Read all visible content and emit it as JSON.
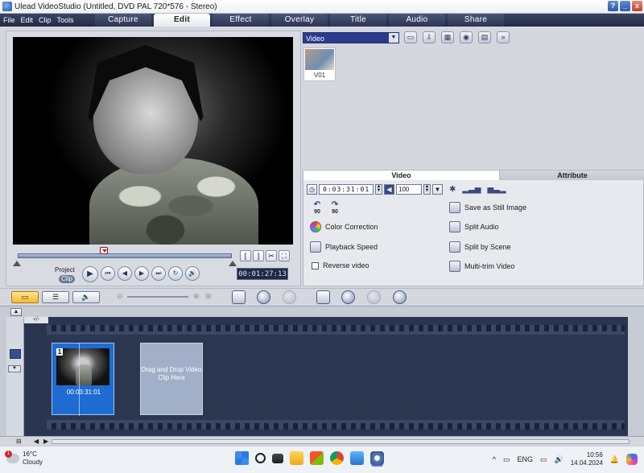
{
  "window": {
    "title": "Ulead VideoStudio (Untitled, DVD PAL 720*576 - Stereo)",
    "btn_help": "?",
    "btn_min": "_",
    "btn_close": "x"
  },
  "menu": [
    "File",
    "Edit",
    "Clip",
    "Tools"
  ],
  "steps": [
    {
      "label": "Capture",
      "active": false
    },
    {
      "label": "Edit",
      "active": true
    },
    {
      "label": "Effect",
      "active": false
    },
    {
      "label": "Overlay",
      "active": false
    },
    {
      "label": "Title",
      "active": false
    },
    {
      "label": "Audio",
      "active": false
    },
    {
      "label": "Share",
      "active": false
    }
  ],
  "preview": {
    "project_label": "Project",
    "clip_label": "Clip",
    "timecode": "00:01:27:13",
    "trim_buttons": [
      "[",
      "]",
      "✂",
      "⛶"
    ],
    "play_glyphs": [
      "▶",
      "⏮",
      "◀",
      "▶",
      "⏭",
      "↻",
      "🔊"
    ]
  },
  "library": {
    "category": "Video",
    "thumbnails": [
      {
        "label": "V01"
      }
    ]
  },
  "options": {
    "tab_video": "Video",
    "tab_attribute": "Attribute",
    "duration": "0:03:31:01",
    "volume": "100",
    "rotate_left": "90",
    "rotate_right": "90",
    "color_correction": "Color Correction",
    "playback_speed": "Playback Speed",
    "reverse_video": "Reverse video",
    "save_still": "Save as Still Image",
    "split_audio": "Split Audio",
    "split_scene": "Split by Scene",
    "multi_trim": "Multi-trim Video"
  },
  "timeline": {
    "clip_number": "1",
    "clip_duration": "00:03:31:01",
    "drop_text": "Drag and Drop Video Clip Here"
  },
  "taskbar": {
    "temperature": "16°C",
    "condition": "Cloudy",
    "weather_badge": "1",
    "language": "ENG",
    "time": "10:56",
    "date": "14.04.2024"
  }
}
